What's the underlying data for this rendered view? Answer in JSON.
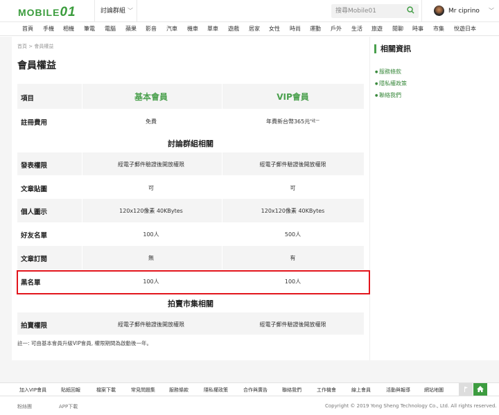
{
  "header": {
    "logo_text": "MOBILE",
    "logo_num": "01",
    "forum_label": "討論群組",
    "search_placeholder": "搜尋Mobile01",
    "username": "Mr ciprino"
  },
  "nav": [
    "首頁",
    "手機",
    "相機",
    "筆電",
    "電腦",
    "蘋果",
    "影音",
    "汽車",
    "機車",
    "單車",
    "遊戲",
    "居家",
    "女性",
    "時尚",
    "運動",
    "戶外",
    "生活",
    "旅遊",
    "閒聊",
    "時事",
    "市集",
    "悅遊日本"
  ],
  "breadcrumb": {
    "home": "首頁",
    "sep": ">",
    "current": "會員權益"
  },
  "page_title": "會員權益",
  "table": {
    "col_label": "項目",
    "col_basic": "基本會員",
    "col_vip": "VIP會員",
    "fee_label": "註冊費用",
    "fee_basic": "免費",
    "fee_vip": "年費新台幣365元",
    "fee_vip_note": "*註一",
    "section_forum": "討論群組相關",
    "rows": [
      {
        "label": "發表權限",
        "basic": "經電子郵件驗證後開放權限",
        "vip": "經電子郵件驗證後開放權限"
      },
      {
        "label": "文章貼圖",
        "basic": "可",
        "vip": "可"
      },
      {
        "label": "個人圖示",
        "basic": "120x120像素 40KBytes",
        "vip": "120x120像素 40KBytes"
      },
      {
        "label": "好友名單",
        "basic": "100人",
        "vip": "500人"
      },
      {
        "label": "文章訂閱",
        "basic": "無",
        "vip": "有"
      },
      {
        "label": "黑名單",
        "basic": "100人",
        "vip": "100人"
      }
    ],
    "section_market": "拍賣市集相關",
    "auction_label": "拍賣權限",
    "auction_basic": "經電子郵件驗證後開放權限",
    "auction_vip": "經電子郵件驗證後開放權限"
  },
  "note": "註一: 可由基本會員升級VIP會員, 權限期間為啟動後一年。",
  "sidebar": {
    "title": "相關資訊",
    "links": [
      "服務條款",
      "隱私權政策",
      "聯絡我們"
    ]
  },
  "footer": {
    "links": [
      "加入VIP會員",
      "貼紙回報",
      "檔案下載",
      "常見問題集",
      "服務條款",
      "隱私權政策",
      "合作與廣告",
      "聯絡我們",
      "工作機會",
      "線上會員",
      "活動與報導",
      "網站地圖"
    ],
    "bottom_left": [
      "粉絲團",
      "APP下載"
    ],
    "copyright": "Copyright © 2019 Yong Sheng Technology Co., Ltd. All rights reserved."
  },
  "colors": {
    "brand_green": "#4aa04d",
    "highlight_red": "#e2141b",
    "row_gray": "#f4f4f4"
  }
}
